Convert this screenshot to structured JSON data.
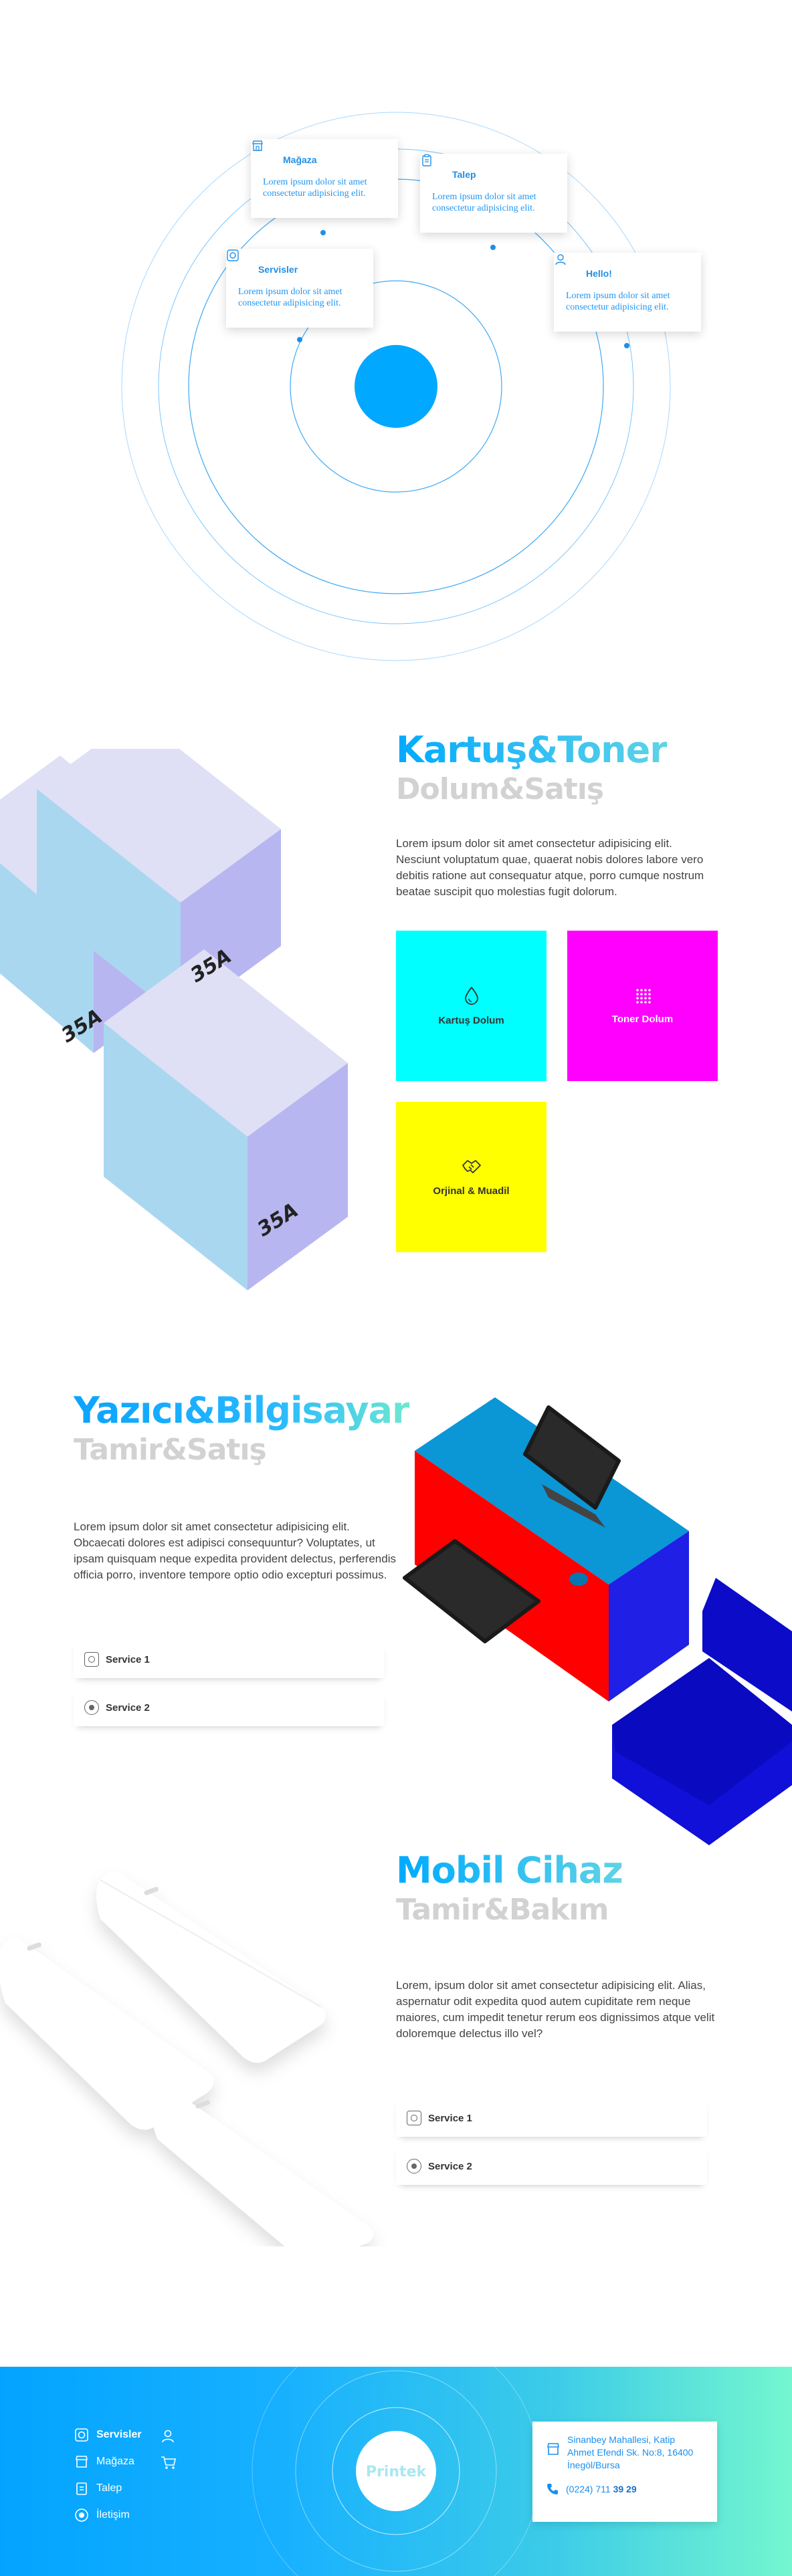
{
  "orbit": {
    "cards": [
      {
        "title": "Mağaza",
        "icon": "store-icon",
        "desc": "Lorem ipsum dolor sit amet consectetur adipisicing elit."
      },
      {
        "title": "Talep",
        "icon": "clipboard-icon",
        "desc": "Lorem ipsum dolor sit amet consectetur adipisicing elit."
      },
      {
        "title": "Servisler",
        "icon": "service-icon",
        "desc": "Lorem ipsum dolor sit amet consectetur adipisicing elit."
      },
      {
        "title": "Hello!",
        "icon": "user-icon",
        "desc": "Lorem ipsum dolor sit amet consectetur adipisicing elit."
      }
    ],
    "accent": "#00a8ff"
  },
  "toner": {
    "title": "Kartuş&Toner",
    "subtitle": "Dolum&Satış",
    "text": "Lorem ipsum dolor sit amet consectetur adipisicing elit. Nesciunt voluptatum quae, quaerat nobis dolores labore vero debitis ratione aut consequatur atque, porro cumque nostrum beatae suscipit quo molestias fugit dolorum.",
    "box_label": "35A",
    "tiles": [
      {
        "label": "Kartuş Dolum",
        "icon": "drop-icon",
        "color": "#00ffff"
      },
      {
        "label": "Toner Dolum",
        "icon": "grid-dots-icon",
        "color": "#ff00ff"
      },
      {
        "label": "Orjinal & Muadil",
        "icon": "handshake-icon",
        "color": "#ffff00"
      }
    ]
  },
  "printer": {
    "title": "Yazıcı&Bilgisayar",
    "subtitle": "Tamir&Satış",
    "text": "Lorem ipsum dolor sit amet consectetur adipisicing elit. Obcaecati dolores est adipisci consequuntur? Voluptates, ut ipsam quisquam neque expedita provident delectus, perferendis officia porro, inventore tempore optio odio excepturi possimus.",
    "services": [
      "Service 1",
      "Service 2"
    ]
  },
  "mobile": {
    "title": "Mobil Cihaz",
    "subtitle": "Tamir&Bakım",
    "text": "Lorem, ipsum dolor sit amet consectetur adipisicing elit. Alias, aspernatur odit expedita quod autem cupiditate rem neque maiores, cum impedit tenetur rerum eos dignissimos atque velit doloremque delectus illo vel?",
    "services": [
      "Service 1",
      "Service 2"
    ]
  },
  "footer": {
    "nav": [
      {
        "label": "Servisler",
        "icon": "service-icon",
        "bold": true
      },
      {
        "label": "Mağaza",
        "icon": "store-icon"
      },
      {
        "label": "Talep",
        "icon": "clipboard-icon"
      },
      {
        "label": "İletişim",
        "icon": "target-icon"
      }
    ],
    "logo": "Printek",
    "address": "Sinanbey Mahallesi, Katip Ahmet Efendi Sk. No:8, 16400 İnegöl/Bursa",
    "phone_prefix": "(0224) 711 ",
    "phone_suffix": "39 29"
  }
}
